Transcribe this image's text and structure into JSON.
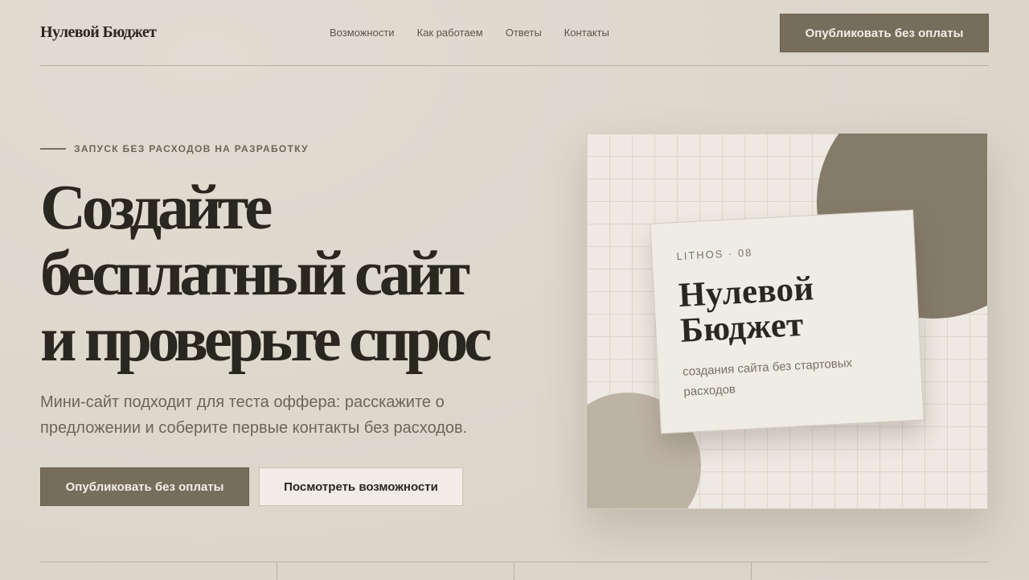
{
  "header": {
    "logo": "Нулевой Бюджет",
    "nav": [
      "Возможности",
      "Как работаем",
      "Ответы",
      "Контакты"
    ],
    "cta_label": "Опубликовать без оплаты"
  },
  "hero": {
    "eyebrow": "ЗАПУСК БЕЗ РАСХОДОВ НА РАЗРАБОТКУ",
    "headline_lines": [
      "Создайте",
      "бесплатный сайт",
      "и проверьте спрос"
    ],
    "subtitle": "Мини-сайт подходит для теста оффера: расскажите о предложении и соберите первые контакты без расходов.",
    "primary_label": "Опубликовать без оплаты",
    "secondary_label": "Посмотреть возможности"
  },
  "card": {
    "kicker": "LITHOS · 08",
    "title_lines": [
      "Нулевой",
      "Бюджет"
    ],
    "subtitle": "создания сайта без стартовых расходов"
  },
  "colors": {
    "accent": "#776d5c",
    "background": "#ddd6cb",
    "text": "#2a2620"
  }
}
